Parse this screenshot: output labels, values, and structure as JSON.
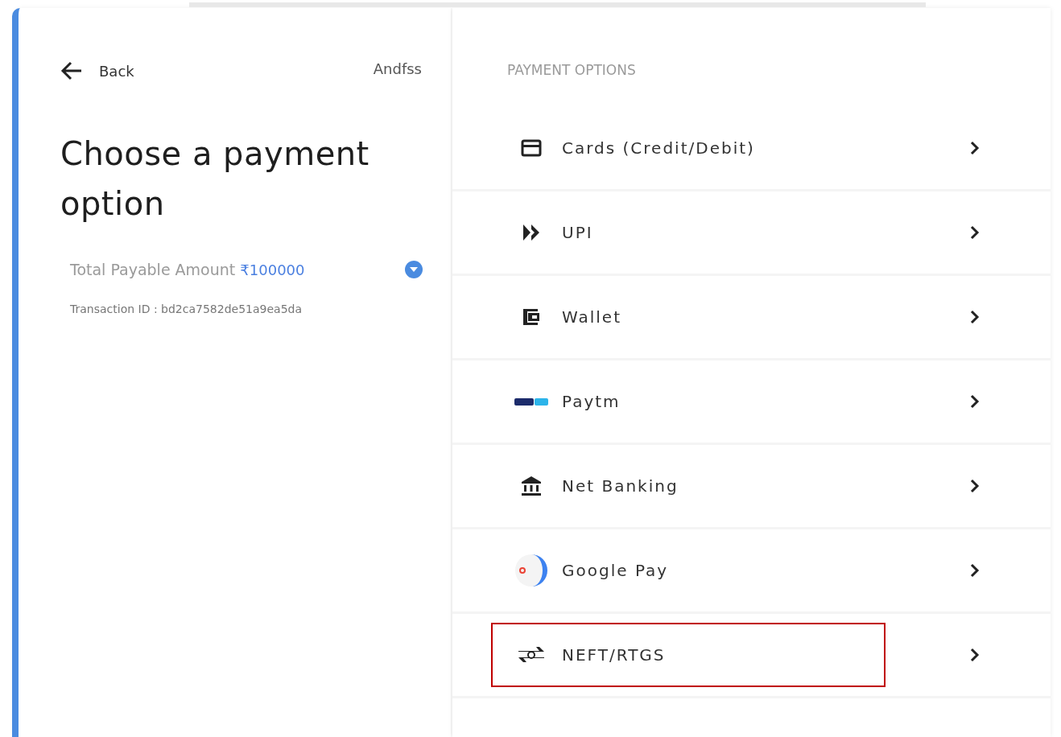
{
  "header": {
    "back": "Back",
    "merchant": "Andfss"
  },
  "title": "Choose a payment option",
  "amount": {
    "label": "Total Payable Amount",
    "value": "₹100000",
    "expanded": false
  },
  "transaction": "Transaction ID : bd2ca7582de51a9ea5da",
  "options_heading": "PAYMENT OPTIONS",
  "options": [
    {
      "kind": "card",
      "label": "Cards (Credit/Debit)",
      "highlighted": false
    },
    {
      "kind": "upi",
      "label": "UPI",
      "highlighted": false
    },
    {
      "kind": "wallet",
      "label": "Wallet",
      "highlighted": false
    },
    {
      "kind": "paytm",
      "label": "Paytm",
      "highlighted": false
    },
    {
      "kind": "bank",
      "label": "Net Banking",
      "highlighted": false
    },
    {
      "kind": "gpay",
      "label": "Google Pay",
      "highlighted": false
    },
    {
      "kind": "transfer",
      "label": "NEFT/RTGS",
      "highlighted": true
    }
  ]
}
